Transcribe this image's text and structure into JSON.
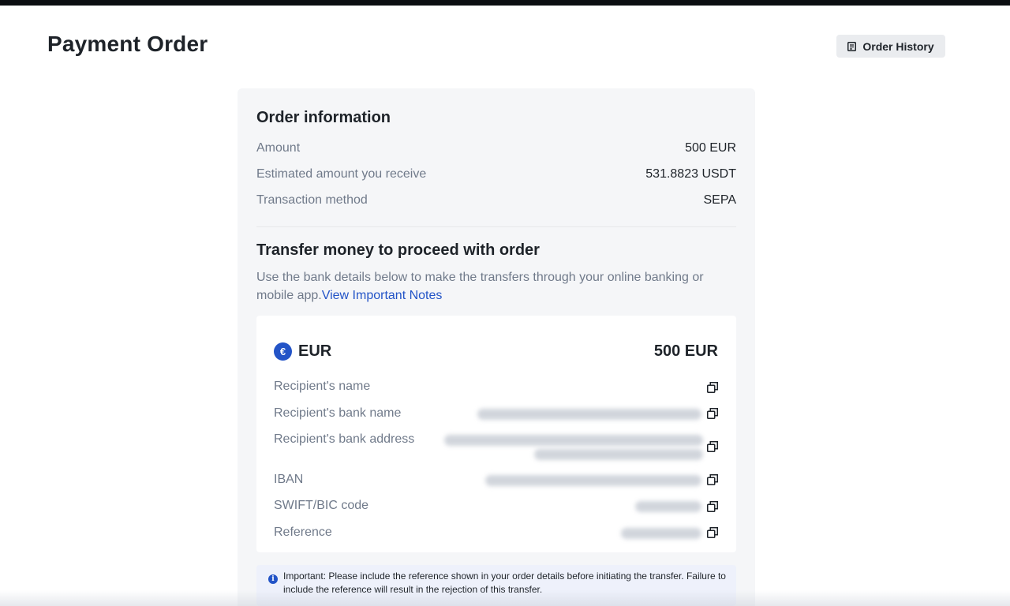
{
  "page": {
    "title": "Payment Order"
  },
  "header": {
    "history_label": "Order History"
  },
  "order_info": {
    "title": "Order information",
    "rows": [
      {
        "label": "Amount",
        "value": "500 EUR"
      },
      {
        "label": "Estimated amount you receive",
        "value": "531.8823 USDT"
      },
      {
        "label": "Transaction method",
        "value": "SEPA"
      }
    ]
  },
  "transfer": {
    "title": "Transfer money to proceed with order",
    "description": "Use the bank details below to make the transfers through your online banking or mobile app.",
    "notes_link": "View Important Notes"
  },
  "bank_details": {
    "currency_symbol": "€",
    "currency_code": "EUR",
    "amount": "500 EUR",
    "rows": [
      {
        "label": "Recipient's name"
      },
      {
        "label": "Recipient's bank name"
      },
      {
        "label": "Recipient's bank address"
      },
      {
        "label": "IBAN"
      },
      {
        "label": "SWIFT/BIC code"
      },
      {
        "label": "Reference"
      }
    ]
  },
  "notice": {
    "icon_glyph": "i",
    "text": "Important: Please include the reference shown in your order details before initiating the transfer. Failure to include the reference will result in the rejection of this transfer."
  },
  "colors": {
    "accent": "#2354c7",
    "card_bg": "#f5f6f8",
    "muted_text": "#707a8a"
  }
}
